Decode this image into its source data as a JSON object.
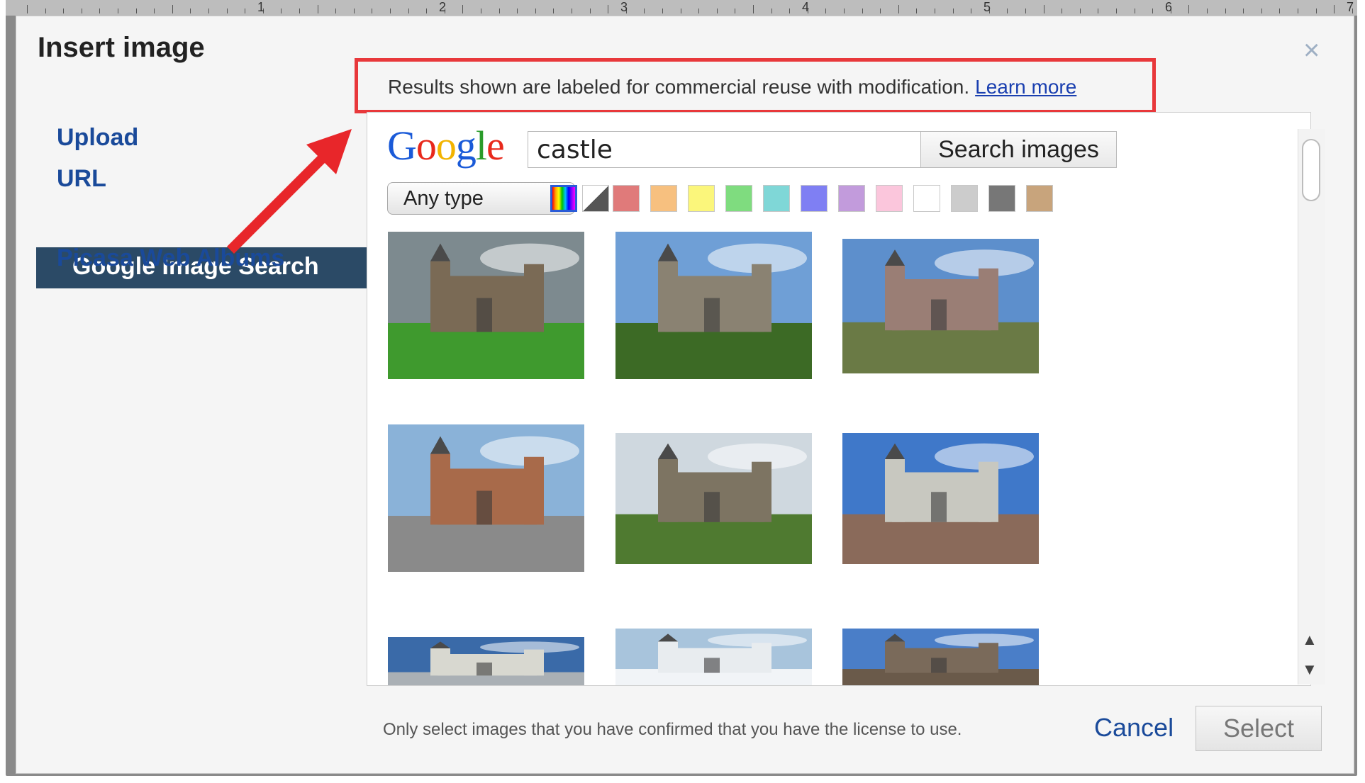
{
  "ruler": {
    "numbers": [
      "1",
      "2",
      "3",
      "4",
      "5",
      "6",
      "7"
    ]
  },
  "dialog": {
    "title": "Insert image",
    "close_glyph": "×"
  },
  "notice": {
    "text": "Results shown are labeled for commercial reuse with modification.",
    "link": "Learn more"
  },
  "sidebar": {
    "items": [
      {
        "label": "Upload"
      },
      {
        "label": "URL"
      },
      {
        "label": "Google Image Search",
        "active": true
      },
      {
        "label": "Picasa Web Albums"
      }
    ],
    "active_color": "#2b4a66"
  },
  "search": {
    "logo_letters": [
      {
        "ch": "G",
        "color": "#1a5ad8"
      },
      {
        "ch": "o",
        "color": "#e8291c"
      },
      {
        "ch": "o",
        "color": "#f2b300"
      },
      {
        "ch": "g",
        "color": "#1a5ad8"
      },
      {
        "ch": "l",
        "color": "#2a9b2a"
      },
      {
        "ch": "e",
        "color": "#e8291c"
      }
    ],
    "query": "castle",
    "button": "Search images",
    "type_filter": "Any type",
    "colors": [
      "#e07a7a",
      "#f7c07f",
      "#fbf67b",
      "#7fdc7f",
      "#7fd7d7",
      "#7f7ff3",
      "#c29bdc",
      "#fbc6dc",
      "#ffffff",
      "#cccccc",
      "#777777",
      "#c8a47c"
    ]
  },
  "results": {
    "images": [
      {
        "name": "castle-result-1",
        "sky": "#7d8a8f",
        "ground": "#3f9a2e",
        "building": "#7a6a55"
      },
      {
        "name": "castle-result-2",
        "sky": "#6f9fd6",
        "ground": "#3c6a25",
        "building": "#8a8272"
      },
      {
        "name": "castle-result-3",
        "sky": "#5d8fcc",
        "ground": "#6a7a45",
        "building": "#9a7e75"
      },
      {
        "name": "castle-result-4",
        "sky": "#8ab2d8",
        "ground": "#8a8a8a",
        "building": "#a86a4a"
      },
      {
        "name": "castle-result-5",
        "sky": "#cfd8df",
        "ground": "#4f7a30",
        "building": "#7d7462"
      },
      {
        "name": "castle-result-6",
        "sky": "#3f78c9",
        "ground": "#8a6a5a",
        "building": "#c8c8c0"
      },
      {
        "name": "castle-result-7",
        "sky": "#3a6aa8",
        "ground": "#aab0b5",
        "building": "#d8d8d0"
      },
      {
        "name": "castle-result-8",
        "sky": "#a8c4dc",
        "ground": "#f1f4f7",
        "building": "#e8ecef"
      },
      {
        "name": "castle-result-9",
        "sky": "#4a7ec8",
        "ground": "#6a5a4a",
        "building": "#7a6a5a"
      }
    ]
  },
  "footer": {
    "disclaimer": "Only select images that you have confirmed that you have the license to use.",
    "cancel": "Cancel",
    "select": "Select"
  },
  "scrollbar": {
    "up": "▲",
    "down": "▼"
  }
}
